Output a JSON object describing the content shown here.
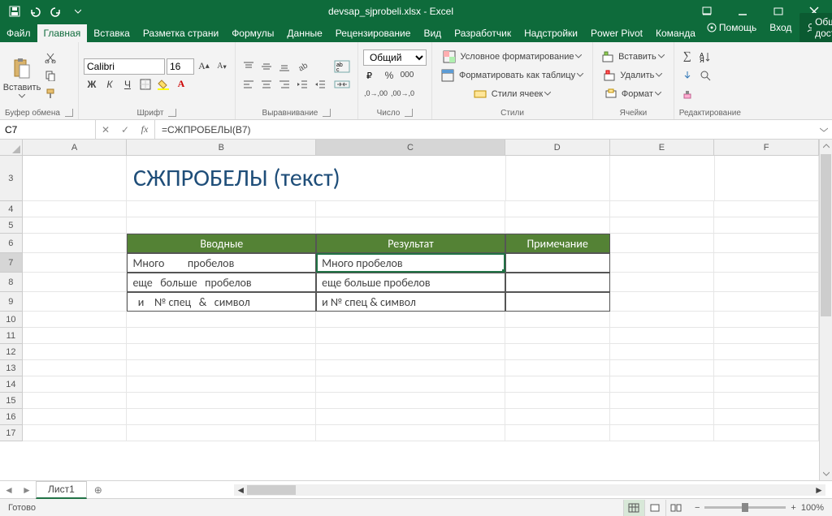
{
  "titlebar": {
    "title": "devsap_sjprobeli.xlsx - Excel"
  },
  "tabs": {
    "file": "Файл",
    "home": "Главная",
    "insert": "Вставка",
    "layout": "Разметка страни",
    "formulas": "Формулы",
    "data": "Данные",
    "review": "Рецензирование",
    "view": "Вид",
    "developer": "Разработчик",
    "addins": "Надстройки",
    "powerpivot": "Power Pivot",
    "team": "Команда",
    "help": "Помощь",
    "login": "Вход",
    "share": "Общий доступ"
  },
  "ribbon": {
    "clipboard": {
      "label": "Буфер обмена",
      "paste": "Вставить"
    },
    "font": {
      "label": "Шрифт",
      "name": "Calibri",
      "size": "16"
    },
    "alignment": {
      "label": "Выравнивание"
    },
    "number": {
      "label": "Число",
      "format": "Общий"
    },
    "styles": {
      "label": "Стили",
      "cond": "Условное форматирование",
      "table": "Форматировать как таблицу",
      "cell": "Стили ячеек"
    },
    "cells": {
      "label": "Ячейки",
      "insert": "Вставить",
      "delete": "Удалить",
      "format": "Формат"
    },
    "editing": {
      "label": "Редактирование"
    }
  },
  "namebox": "C7",
  "formula": "=СЖПРОБЕЛЫ(B7)",
  "columns": [
    "A",
    "B",
    "C",
    "D",
    "E",
    "F"
  ],
  "rows": [
    "3",
    "4",
    "5",
    "6",
    "7",
    "8",
    "9",
    "10",
    "11",
    "12",
    "13",
    "14",
    "15",
    "16",
    "17"
  ],
  "sheet": {
    "title_cell": "СЖПРОБЕЛЫ (текст)",
    "headers": {
      "b": "Вводные",
      "c": "Результат",
      "d": "Примечание"
    },
    "data": [
      {
        "b": "Много         пробелов  ",
        "c": "Много пробелов",
        "d": ""
      },
      {
        "b": "еще   больше   пробелов",
        "c": "еще больше пробелов",
        "d": ""
      },
      {
        "b": "  и    № спец   &   символ",
        "c": "и № спец & символ",
        "d": ""
      }
    ]
  },
  "sheettab": "Лист1",
  "status": {
    "ready": "Готово",
    "zoom": "100%"
  }
}
